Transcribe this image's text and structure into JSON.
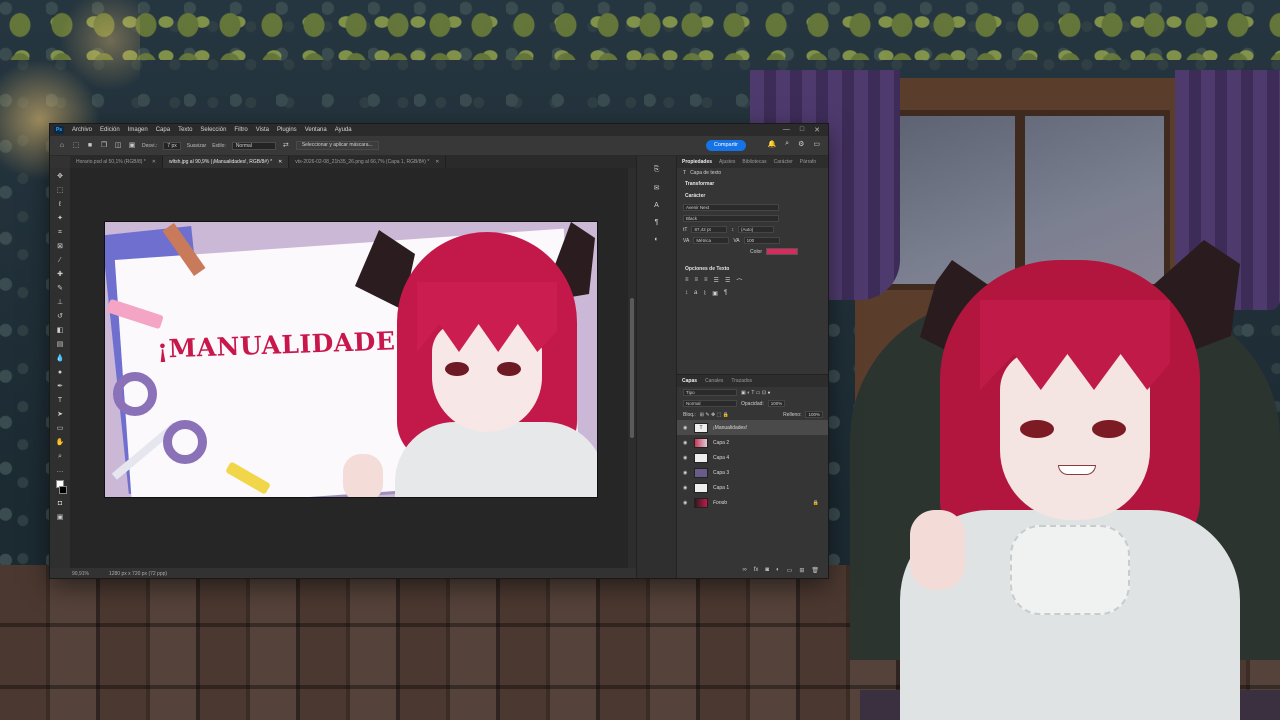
{
  "app": {
    "menu": [
      "Archivo",
      "Edición",
      "Imagen",
      "Capa",
      "Texto",
      "Selección",
      "Filtro",
      "Vista",
      "Plugins",
      "Ventana",
      "Ayuda"
    ],
    "logo": "Ps",
    "window_controls": [
      "—",
      "□",
      "✕"
    ]
  },
  "options": {
    "size_label": "Desvi.:",
    "size_value": "7 px",
    "smooth_label": "Suavizar",
    "style_label": "Estilo:",
    "style_value": "Normal",
    "select_mask_button": "Seleccionar y aplicar máscara...",
    "share_button": "Compartir"
  },
  "tabs": [
    {
      "label": "Horario.psd al 50,1% (RGB/8) *",
      "active": false
    },
    {
      "label": "wltsh.jpg al 90,9% (¡Manualidades!, RGB/8#) *",
      "active": true
    },
    {
      "label": "vts-2026-02-08_21h35_26.png al 66,7% (Capa 1, RGB/8#) *",
      "active": false
    }
  ],
  "artwork": {
    "title_text": "¡MANUALIDADES!"
  },
  "status": {
    "zoom": "90,91%",
    "dimensions": "1280 px x 720 px (72 ppp)"
  },
  "properties": {
    "tabs": [
      "Propiedades",
      "Ajustes",
      "Bibliotecas",
      "Carácter",
      "Párrafo"
    ],
    "layer_type": "Capa de texto",
    "transform_section": "Transformar",
    "character_section": "Carácter",
    "font_family": "Avenir Next",
    "font_style": "Black",
    "font_size": "87,42 pt",
    "leading": "(Auto)",
    "kerning": "Métrica",
    "tracking": "100",
    "color_label": "Color",
    "text_options_section": "Opciones de Texto",
    "text_color": "#d82a5c"
  },
  "layers": {
    "tabs": [
      "Capas",
      "Canales",
      "Trazados"
    ],
    "filter_label": "Tipo",
    "blend_mode": "Normal",
    "opacity_label": "Opacidad:",
    "opacity_value": "100%",
    "lock_label": "Bloq.:",
    "fill_label": "Relleno:",
    "fill_value": "100%",
    "items": [
      {
        "name": "¡Manualidades!",
        "thumb": "T",
        "active": true
      },
      {
        "name": "Capa 2",
        "thumb": "",
        "active": false
      },
      {
        "name": "Capa 4",
        "thumb": "",
        "active": false
      },
      {
        "name": "Capa 3",
        "thumb": "",
        "active": false
      },
      {
        "name": "Capa 1",
        "thumb": "",
        "active": false
      },
      {
        "name": "Fondo",
        "thumb": "",
        "active": false
      }
    ]
  }
}
